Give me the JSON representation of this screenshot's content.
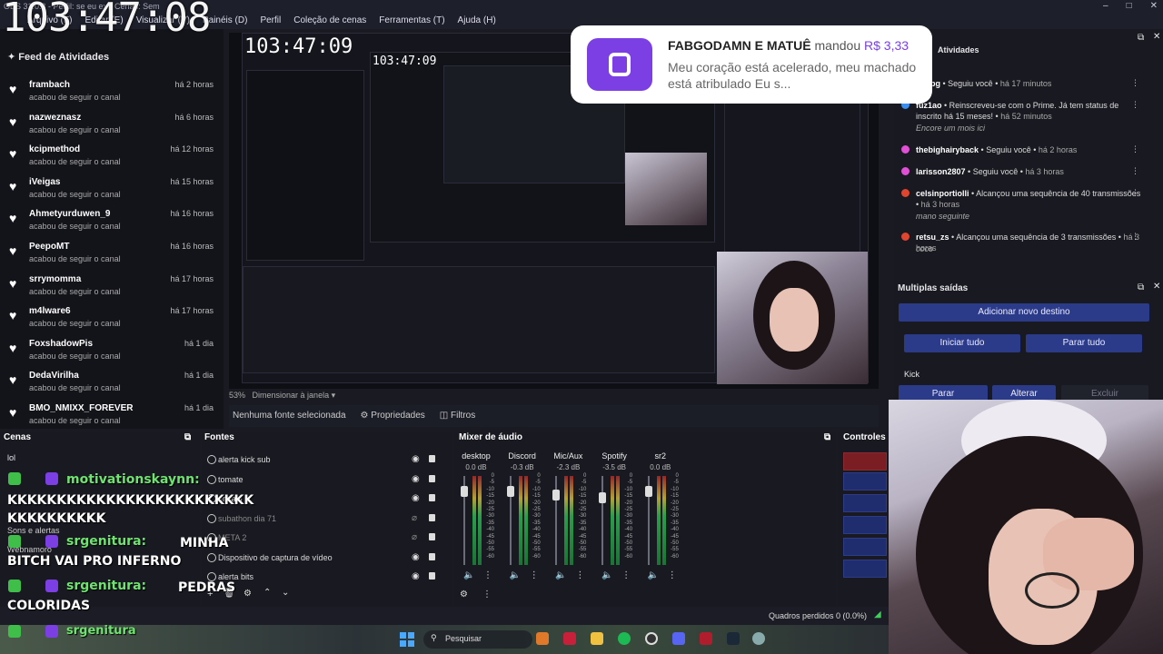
{
  "window": {
    "title": "OBS 31.0.3 - Perfil: se eu ex - Cenas: Sem"
  },
  "clock": {
    "big": "103:47:08",
    "nested": "103:47:09",
    "nested2": "103:47:09"
  },
  "menu": [
    "Arquivo (F)",
    "Editar (E)",
    "Visualizar (V)",
    "Painéis (D)",
    "Perfil",
    "Coleção de cenas",
    "Ferramentas (T)",
    "Ajuda (H)"
  ],
  "feed": {
    "title": "Feed de Atividades",
    "items": [
      {
        "name": "frambach",
        "time": "há 2 horas",
        "sub": "acabou de seguir o canal"
      },
      {
        "name": "nazweznasz",
        "time": "há 6 horas",
        "sub": "acabou de seguir o canal"
      },
      {
        "name": "kcipmethod",
        "time": "há 12 horas",
        "sub": "acabou de seguir o canal"
      },
      {
        "name": "iVeigas",
        "time": "há 15 horas",
        "sub": "acabou de seguir o canal"
      },
      {
        "name": "Ahmetyurduwen_9",
        "time": "há 16 horas",
        "sub": "acabou de seguir o canal"
      },
      {
        "name": "PeepoMT",
        "time": "há 16 horas",
        "sub": "acabou de seguir o canal"
      },
      {
        "name": "srrymomma",
        "time": "há 17 horas",
        "sub": "acabou de seguir o canal"
      },
      {
        "name": "m4lware6",
        "time": "há 17 horas",
        "sub": "acabou de seguir o canal"
      },
      {
        "name": "FoxshadowPis",
        "time": "há 1 dia",
        "sub": "acabou de seguir o canal"
      },
      {
        "name": "DedaVirilha",
        "time": "há 1 dia",
        "sub": "acabou de seguir o canal"
      },
      {
        "name": "BMO_NMIXX_FOREVER",
        "time": "há 1 dia",
        "sub": "acabou de seguir o canal"
      }
    ]
  },
  "donation": {
    "from": "FABGODAMN E MATUÊ",
    "verb": "mandou",
    "amount": "R$ 3,33",
    "message": "Meu coração está acelerado, meu machado está atribulado Eu s..."
  },
  "chatdock": {
    "title": "Atividades",
    "items": [
      {
        "name": "gygpg",
        "text": "Seguiu você",
        "time": "há 17 minutos",
        "color": "#e14fd6",
        "note": ""
      },
      {
        "name": "fuz1ao",
        "text": "Reinscreveu-se com o Prime. Já tem status de inscrito há 15 meses!",
        "time": "há 52 minutos",
        "color": "#3a8ff0",
        "note": "Encore um mois ici"
      },
      {
        "name": "thebighairyback",
        "text": "Seguiu você",
        "time": "há 2 horas",
        "color": "#e14fd6",
        "note": ""
      },
      {
        "name": "larisson2807",
        "text": "Seguiu você",
        "time": "há 3 horas",
        "color": "#e14fd6",
        "note": ""
      },
      {
        "name": "celsinportiolli",
        "text": "Alcançou uma sequência de 40 transmissões",
        "time": "há 3 horas",
        "color": "#e0452e",
        "note": "mano seguinte"
      },
      {
        "name": "retsu_zs",
        "text": "Alcançou uma sequência de 3 transmissões",
        "time": "há 3 horas",
        "color": "#e0452e",
        "note": "coco"
      }
    ]
  },
  "multi": {
    "title": "Multiplas saídas",
    "add": "Adicionar novo destino",
    "start_all": "Iniciar tudo",
    "stop_all": "Parar tudo",
    "platform": "Kick",
    "stop": "Parar",
    "edit": "Alterar",
    "delete": "Excluir"
  },
  "preview": {
    "zoom": "53%",
    "resize": "Dimensionar à janela",
    "no_source": "Nenhuma fonte selecionada",
    "properties": "Propriedades",
    "filters": "Filtros"
  },
  "docks": {
    "scenes": "Cenas",
    "sources": "Fontes",
    "mixer": "Mixer de áudio",
    "controls": "Controles"
  },
  "scenes": [
    "lol",
    "Sons e alertas",
    "Webnamoro"
  ],
  "sources": [
    {
      "name": "alerta kick sub",
      "visible": true,
      "dim": false
    },
    {
      "name": "tomate",
      "visible": true,
      "dim": false
    },
    {
      "name": "ensaio",
      "visible": true,
      "dim": false
    },
    {
      "name": "subathon dia 71",
      "visible": false,
      "dim": true
    },
    {
      "name": "META 2",
      "visible": false,
      "dim": true
    },
    {
      "name": "Dispositivo de captura de vídeo",
      "visible": true,
      "dim": false
    },
    {
      "name": "alerta bits",
      "visible": true,
      "dim": false
    }
  ],
  "mixer": [
    {
      "name": "desktop",
      "db": "0.0 dB",
      "level": 0.82
    },
    {
      "name": "Discord",
      "db": "-0.3 dB",
      "level": 0.82
    },
    {
      "name": "Mic/Aux",
      "db": "-2.3 dB",
      "level": 0.75
    },
    {
      "name": "Spotify",
      "db": "-3.5 dB",
      "level": 0.7
    },
    {
      "name": "sr2",
      "db": "0.0 dB",
      "level": 0.82
    }
  ],
  "meter_scale": [
    "0",
    "-5",
    "-10",
    "-15",
    "-20",
    "-25",
    "-30",
    "-35",
    "-40",
    "-45",
    "-50",
    "-55",
    "-60"
  ],
  "overlay_chat": [
    {
      "user": "motivationskaynn:",
      "msg": "KKKKKKKKKKKKKKKKKKKKKKKKK KKKKKKKKKK"
    },
    {
      "user": "srgenitura:",
      "msg": "MINHA BITCH VAI PRO INFERNO"
    },
    {
      "user": "srgenitura:",
      "msg": "PEDRAS COLORIDAS"
    },
    {
      "user": "srgenitura",
      "msg": ""
    }
  ],
  "status": {
    "dropped": "Quadros perdidos 0 (0.0%)"
  },
  "taskbar": {
    "search": "Pesquisar"
  },
  "colors": {
    "accent": "#2c3a8a",
    "brand_purple": "#7b3fe4"
  }
}
